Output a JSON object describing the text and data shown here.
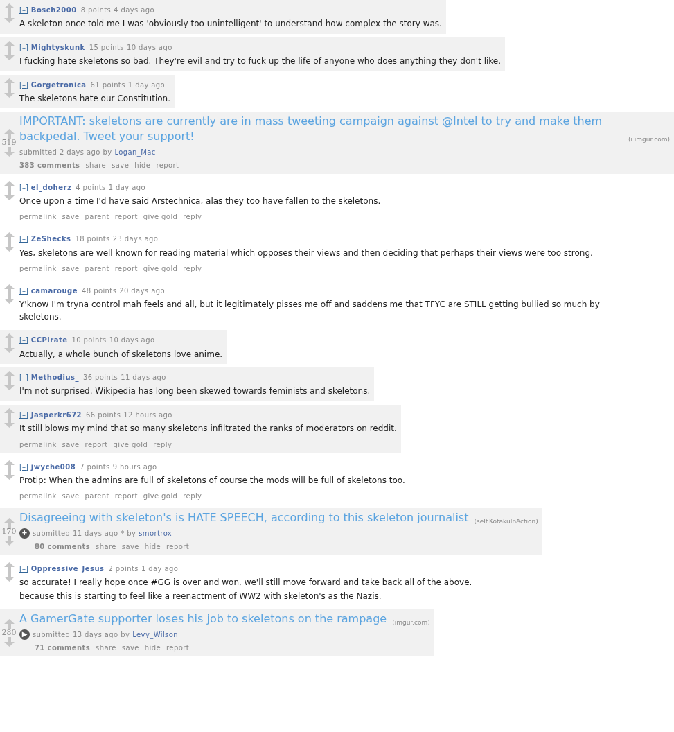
{
  "entries": [
    {
      "kind": "comment",
      "shaded": true,
      "toggle": "[–]",
      "author": "Bosch2000",
      "points": "8 points",
      "time": "4 days ago",
      "body": [
        "A skeleton once told me I was 'obviously too unintelligent' to understand how complex the story was."
      ]
    },
    {
      "kind": "comment",
      "shaded": true,
      "toggle": "[–]",
      "author": "Mightyskunk",
      "points": "15 points",
      "time": "10 days ago",
      "body": [
        "I fucking hate skeletons so bad. They're evil and try to fuck up the life of anyone who does anything they don't like."
      ]
    },
    {
      "kind": "comment",
      "shaded": true,
      "toggle": "[–]",
      "author": "Gorgetronica",
      "points": "61 points",
      "time": "1 day ago",
      "body": [
        "The skeletons hate our Constitution."
      ]
    },
    {
      "kind": "post",
      "shaded": true,
      "score": "519",
      "title": "IMPORTANT: skeletons are currently are in mass tweeting campaign against @Intel to try and make them backpedal. Tweet your support!",
      "domain": "(i.imgur.com)",
      "submitted": "submitted 2 days ago by",
      "author": "Logan_Mac",
      "links": [
        "383 comments",
        "share",
        "save",
        "hide",
        "report"
      ]
    },
    {
      "kind": "comment",
      "shaded": false,
      "toggle": "[–]",
      "author": "el_doherz",
      "points": "4 points",
      "time": "1 day ago",
      "body": [
        "Once upon a time I'd have said Arstechnica, alas they too have fallen to the skeletons."
      ],
      "actions": [
        "permalink",
        "save",
        "parent",
        "report",
        "give gold",
        "reply"
      ]
    },
    {
      "kind": "comment",
      "shaded": false,
      "toggle": "[–]",
      "author": "ZeShecks",
      "points": "18 points",
      "time": "23 days ago",
      "body": [
        "Yes, skeletons are well known for reading material which opposes their views and then deciding that perhaps their views were too strong."
      ],
      "actions": [
        "permalink",
        "save",
        "parent",
        "report",
        "give gold",
        "reply"
      ]
    },
    {
      "kind": "comment",
      "shaded": false,
      "toggle": "[–]",
      "author": "camarouge",
      "points": "48 points",
      "time": "20 days ago",
      "body": [
        "Y'know I'm tryna control mah feels and all, but it legitimately pisses me off and saddens me that TFYC are STILL getting bullied so much by skeletons."
      ]
    },
    {
      "kind": "comment",
      "shaded": true,
      "toggle": "[–]",
      "author": "CCPirate",
      "points": "10 points",
      "time": "10 days ago",
      "body": [
        "Actually, a whole bunch of skeletons love anime."
      ]
    },
    {
      "kind": "comment",
      "shaded": true,
      "toggle": "[–]",
      "author": "Methodius_",
      "points": "36 points",
      "time": "11 days ago",
      "body": [
        "I'm not surprised. Wikipedia has long been skewed towards feminists and skeletons."
      ]
    },
    {
      "kind": "comment",
      "shaded": true,
      "toggle": "[–]",
      "author": "Jasperkr672",
      "points": "66 points",
      "time": "12 hours ago",
      "body": [
        "It still blows my mind that so many skeletons infiltrated the ranks of moderators on reddit."
      ],
      "actions": [
        "permalink",
        "save",
        "report",
        "give gold",
        "reply"
      ]
    },
    {
      "kind": "comment",
      "shaded": false,
      "toggle": "[–]",
      "author": "jwyche008",
      "points": "7 points",
      "time": "9 hours ago",
      "body": [
        "Protip: When the admins are full of skeletons of course the mods will be full of skeletons too."
      ],
      "actions": [
        "permalink",
        "save",
        "parent",
        "report",
        "give gold",
        "reply"
      ]
    },
    {
      "kind": "post",
      "shaded": true,
      "score": "170",
      "title": "Disagreeing with skeleton's is HATE SPEECH, according to this skeleton journalist",
      "domain": "(self.KotakuInAction)",
      "thumb": "+",
      "submitted": "submitted 11 days ago * by",
      "author": "smortrox",
      "links": [
        "80 comments",
        "share",
        "save",
        "hide",
        "report"
      ]
    },
    {
      "kind": "comment",
      "shaded": false,
      "toggle": "[–]",
      "author": "Oppressive_Jesus",
      "points": "2 points",
      "time": "1 day ago",
      "body": [
        "so accurate! I really hope once #GG is over and won, we'll still move forward and take back all of the above.",
        "because this is starting to feel like a reenactment of WW2 with skeleton's as the Nazis."
      ]
    },
    {
      "kind": "post",
      "shaded": true,
      "score": "280",
      "title": "A GamerGate supporter loses his job to skeletons on the rampage",
      "domain": "(imgur.com)",
      "thumb": "▶",
      "submitted": "submitted 13 days ago by",
      "author": "Levy_Wilson",
      "links": [
        "71 comments",
        "share",
        "save",
        "hide",
        "report"
      ]
    }
  ]
}
